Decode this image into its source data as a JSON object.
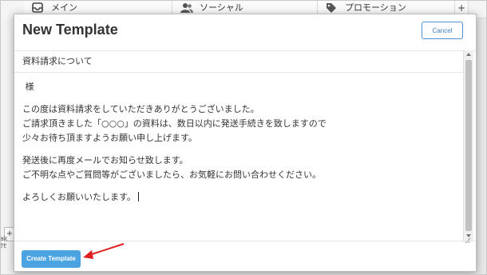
{
  "background": {
    "tabs": [
      {
        "label": "メイン",
        "icon": "inbox-icon"
      },
      {
        "label": "ソーシャル",
        "icon": "people-icon"
      },
      {
        "label": "プロモーション",
        "icon": "tag-icon"
      }
    ],
    "add_tab": "+",
    "left_box": "+",
    "left_text": "ak\nｸｾ"
  },
  "modal": {
    "title": "New Template",
    "cancel_label": "Cancel",
    "subject": "資料請求について",
    "body": {
      "greeting": "様",
      "para1_line1": "この度は資料請求をしていただきありがとうございました。",
      "para1_line2": "ご請求頂きました「○○○」の資料は、数日以内に発送手続きを致しますので",
      "para1_line3": "少々お待ち頂ますようお願い申し上げます。",
      "para2_line1": "発送後に再度メールでお知らせ致します。",
      "para2_line2": "ご不明な点やご質問等がございましたら、お気軽にお問い合わせください。",
      "closing": "よろしくお願いいたします。"
    },
    "create_label": "Create Template"
  },
  "colors": {
    "primary_button": "#4ba3e2",
    "cancel_border": "#4a90d9",
    "annotation_arrow": "#e02020"
  }
}
